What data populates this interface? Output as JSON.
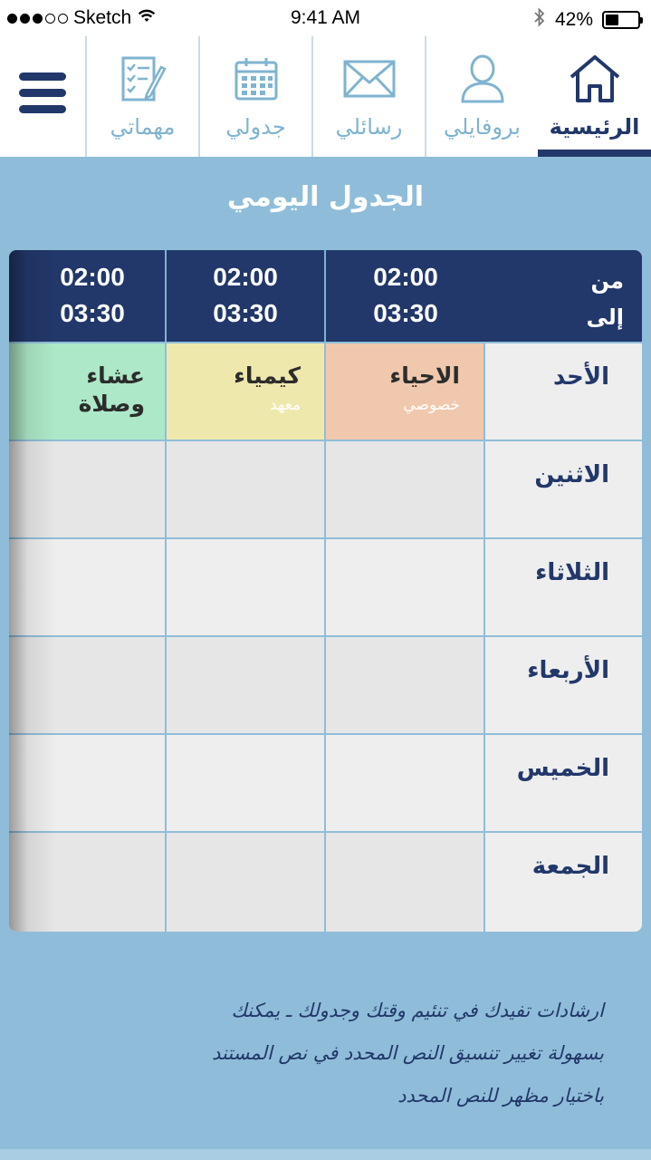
{
  "status_bar": {
    "carrier": "Sketch",
    "time": "9:41 AM",
    "battery": "42%",
    "battery_level": 0.42,
    "signal_dots_filled": 3,
    "signal_dots_total": 5,
    "icons": [
      "wifi-icon",
      "bluetooth-icon",
      "battery-icon"
    ]
  },
  "nav": {
    "tabs": [
      {
        "label": "الرئيسية",
        "icon": "home-icon",
        "active": true
      },
      {
        "label": "بروفايلي",
        "icon": "user-icon",
        "active": false
      },
      {
        "label": "رسائلي",
        "icon": "envelope-icon",
        "active": false
      },
      {
        "label": "جدولي",
        "icon": "calendar-icon",
        "active": false
      },
      {
        "label": "مهماتي",
        "icon": "tasks-icon",
        "active": false
      }
    ],
    "menu_icon": "hamburger-menu-icon"
  },
  "page_title": "الجدول اليومي",
  "timetable": {
    "header_from": "من",
    "header_to": "إلى",
    "time_slots": [
      {
        "from": "02:00",
        "to": "03:30"
      },
      {
        "from": "02:00",
        "to": "03:30"
      },
      {
        "from": "02:00",
        "to": "03:30"
      }
    ],
    "days": [
      "الأحد",
      "الاثنين",
      "الثلاثاء",
      "الأربعاء",
      "الخميس",
      "الجمعة"
    ],
    "sunday_entries": [
      {
        "subject": "الاحياء",
        "note": "خصوصي",
        "color": "#efc8ad"
      },
      {
        "subject": "كيمياء",
        "note": "معهد",
        "color": "#efe8ad"
      },
      {
        "subject": "عشاء وصلاة",
        "subject_line1": "عشاء",
        "subject_line2": "وصلاة",
        "note": "",
        "color": "#ade8c8"
      }
    ]
  },
  "footer_text": {
    "line1": "ارشادات تفيدك في تنئيم وقتك وجدولك ـ يمكنك",
    "line2": "بسهولة تغيير تنسيق النص المحدد في نص المستند",
    "line3": "باختيار مظهر للنص المحدد"
  },
  "colors": {
    "primary": "#22376a",
    "background": "#8fbdd9",
    "accent_light": "#7fb3d0"
  }
}
